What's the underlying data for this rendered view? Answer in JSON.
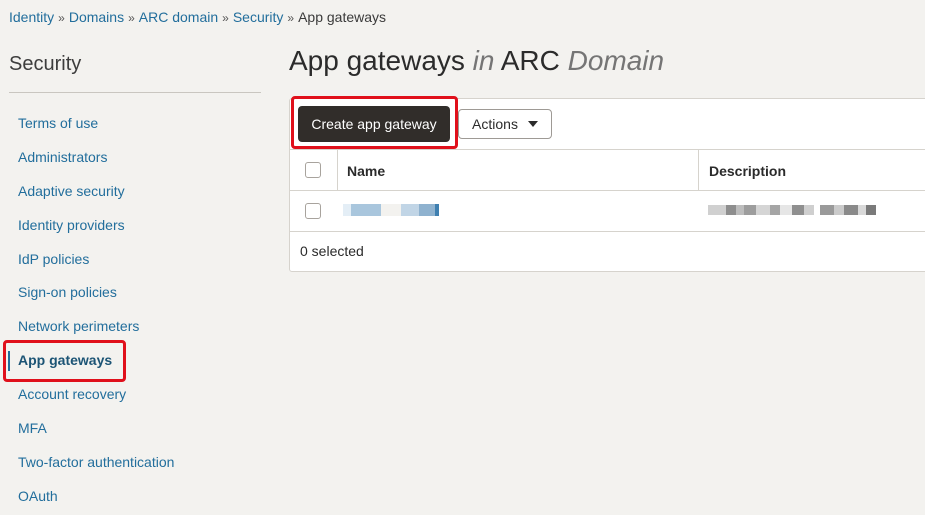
{
  "breadcrumb": {
    "items": [
      "Identity",
      "Domains",
      "ARC domain",
      "Security"
    ],
    "current": "App gateways",
    "separator": "»"
  },
  "sidebar": {
    "title": "Security",
    "items": [
      {
        "label": "Terms of use"
      },
      {
        "label": "Administrators"
      },
      {
        "label": "Adaptive security"
      },
      {
        "label": "Identity providers"
      },
      {
        "label": "IdP policies"
      },
      {
        "label": "Sign-on policies"
      },
      {
        "label": "Network perimeters"
      },
      {
        "label": "App gateways",
        "active": true
      },
      {
        "label": "Account recovery"
      },
      {
        "label": "MFA"
      },
      {
        "label": "Two-factor authentication"
      },
      {
        "label": "OAuth"
      }
    ]
  },
  "main": {
    "title_main": "App gateways",
    "title_in": "in",
    "title_domain": "ARC",
    "title_domain_suffix": "Domain"
  },
  "toolbar": {
    "create_label": "Create app gateway",
    "actions_label": "Actions"
  },
  "table": {
    "columns": [
      "Name",
      "Description"
    ],
    "rows": [
      {
        "name": "",
        "description": ""
      }
    ],
    "footer": "0 selected"
  },
  "colors": {
    "link": "#226e9c",
    "primary_button": "#312d2a",
    "highlight": "#e0101b",
    "background": "#f3f2ef"
  },
  "icons": {
    "actions_dropdown": "caret-down-icon"
  }
}
